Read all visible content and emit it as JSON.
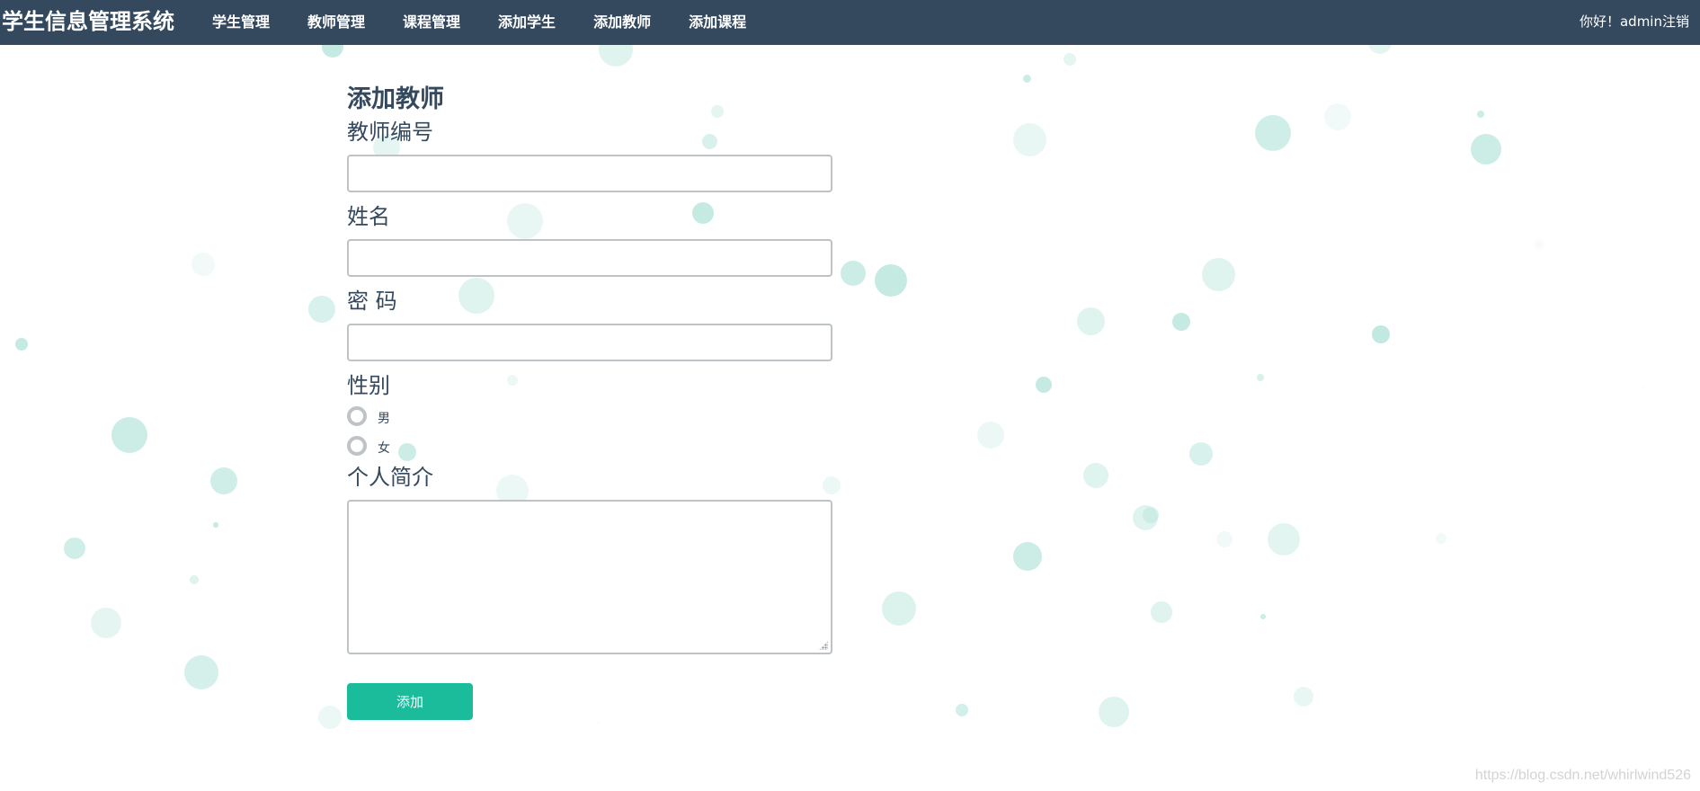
{
  "navbar": {
    "brand": "学生信息管理系统",
    "items": [
      {
        "label": "学生管理"
      },
      {
        "label": "教师管理"
      },
      {
        "label": "课程管理"
      },
      {
        "label": "添加学生"
      },
      {
        "label": "添加教师"
      },
      {
        "label": "添加课程"
      }
    ],
    "greeting": "你好！admin",
    "logout": "注销"
  },
  "form": {
    "title": "添加教师",
    "teacher_id_label": "教师编号",
    "teacher_id_value": "",
    "name_label": "姓名",
    "name_value": "",
    "password_label": "密 码",
    "password_value": "",
    "gender_label": "性别",
    "gender_options": [
      {
        "label": "男",
        "selected": false
      },
      {
        "label": "女",
        "selected": false
      }
    ],
    "intro_label": "个人简介",
    "intro_value": "",
    "submit_label": "添加"
  },
  "watermark": "https://blog.csdn.net/whirlwind526",
  "colors": {
    "navbar_bg": "#34495e",
    "accent": "#1abc9c",
    "text": "#34495e",
    "border": "#bdc3c7",
    "bubble": "#bfe8df"
  }
}
